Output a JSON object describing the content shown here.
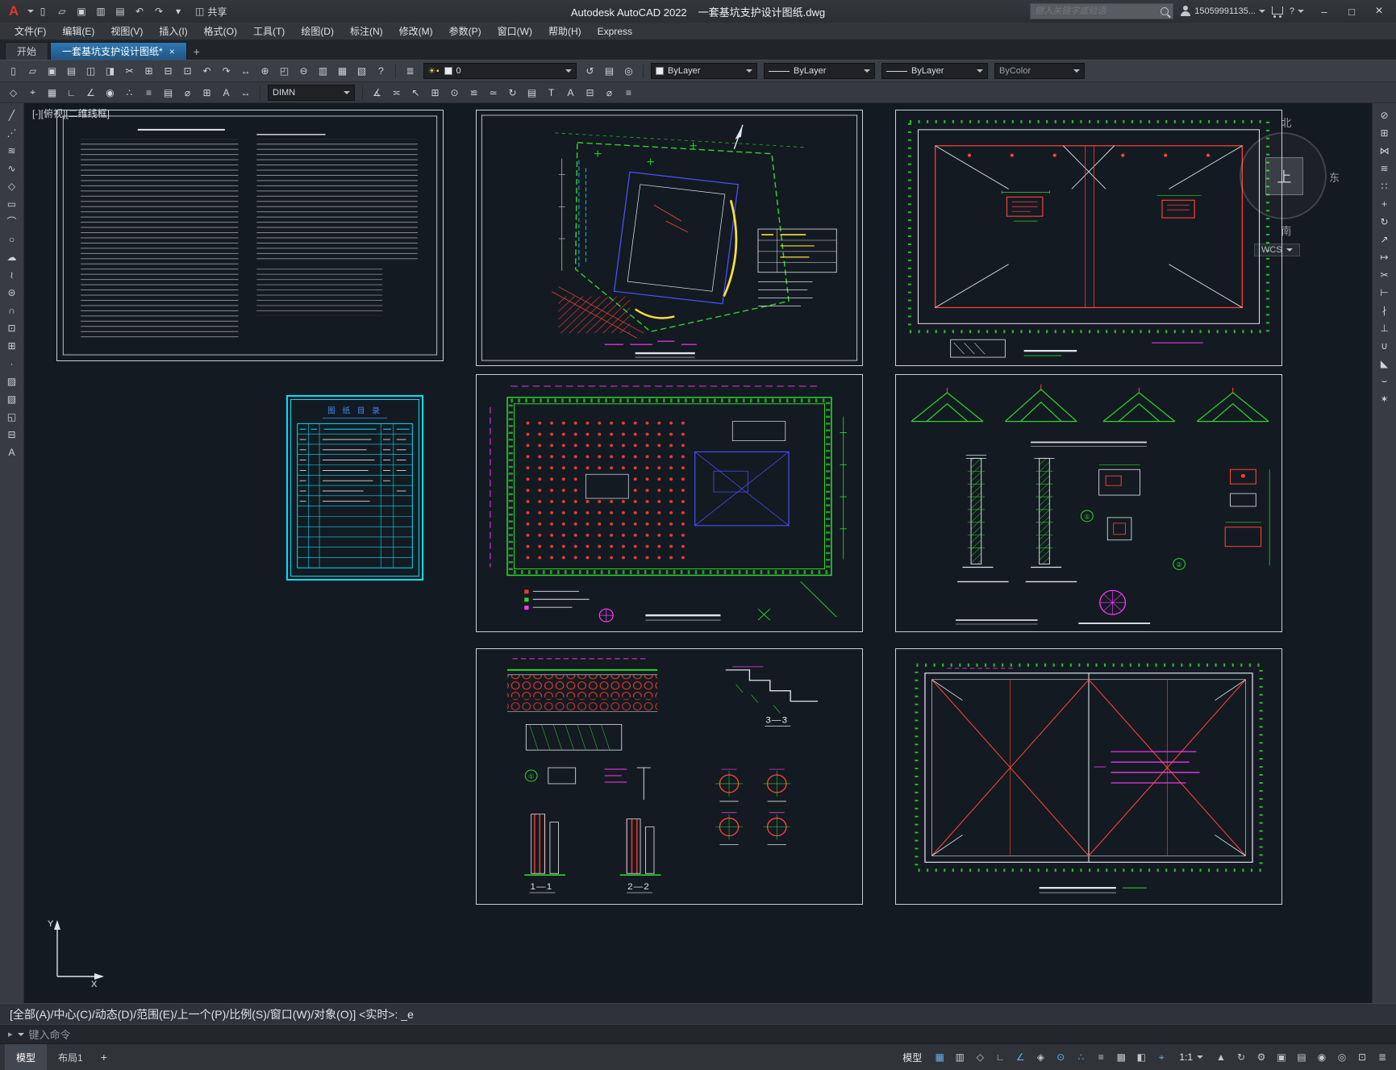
{
  "titlebar": {
    "logo_glyph": "A",
    "qat_icons": [
      {
        "name": "new-file-icon",
        "glyph": "▯"
      },
      {
        "name": "open-icon",
        "glyph": "▱"
      },
      {
        "name": "save-icon",
        "glyph": "▣"
      },
      {
        "name": "save-as-icon",
        "glyph": "▥"
      },
      {
        "name": "plot-icon",
        "glyph": "▤"
      },
      {
        "name": "undo-icon",
        "glyph": "↶"
      },
      {
        "name": "redo-icon",
        "glyph": "↷"
      },
      {
        "name": "qat-customize-icon",
        "glyph": "▾"
      }
    ],
    "share_icon_glyph": "◫",
    "share_label": "共享",
    "title_app": "Autodesk AutoCAD 2022",
    "title_file": "一套基坑支护设计图纸.dwg",
    "search_placeholder": "键入关键字或短语",
    "account_user": "15059991135...",
    "help_label": "?",
    "window": {
      "minimize": "–",
      "maximize": "□",
      "close": "×"
    }
  },
  "menubar": {
    "items": [
      {
        "name": "menu-file",
        "label": "文件(F)"
      },
      {
        "name": "menu-edit",
        "label": "编辑(E)"
      },
      {
        "name": "menu-view",
        "label": "视图(V)"
      },
      {
        "name": "menu-insert",
        "label": "插入(I)"
      },
      {
        "name": "menu-format",
        "label": "格式(O)"
      },
      {
        "name": "menu-tools",
        "label": "工具(T)"
      },
      {
        "name": "menu-draw",
        "label": "绘图(D)"
      },
      {
        "name": "menu-dimension",
        "label": "标注(N)"
      },
      {
        "name": "menu-modify",
        "label": "修改(M)"
      },
      {
        "name": "menu-parametric",
        "label": "参数(P)"
      },
      {
        "name": "menu-window",
        "label": "窗口(W)"
      },
      {
        "name": "menu-help",
        "label": "帮助(H)"
      },
      {
        "name": "menu-express",
        "label": "Express"
      }
    ]
  },
  "tabs": {
    "start_label": "开始",
    "doc_label": "一套基坑支护设计图纸*",
    "close_glyph": "×",
    "add_glyph": "+"
  },
  "toolbar_row1": {
    "icons": [
      {
        "name": "new-file-icon",
        "glyph": "▯"
      },
      {
        "name": "open-icon",
        "glyph": "▱"
      },
      {
        "name": "save-icon",
        "glyph": "▣"
      },
      {
        "name": "plot-icon",
        "glyph": "▤"
      },
      {
        "name": "plot-preview-icon",
        "glyph": "◫"
      },
      {
        "name": "publish-icon",
        "glyph": "◨"
      },
      {
        "name": "cut-icon",
        "glyph": "✂"
      },
      {
        "name": "copy-icon",
        "glyph": "⊞"
      },
      {
        "name": "paste-icon",
        "glyph": "⊟"
      },
      {
        "name": "match-properties-icon",
        "glyph": "⊡"
      },
      {
        "name": "undo-icon",
        "glyph": "↶"
      },
      {
        "name": "redo-icon",
        "glyph": "↷"
      },
      {
        "name": "pan-icon",
        "glyph": "↔"
      },
      {
        "name": "zoom-realtime-icon",
        "glyph": "⊕"
      },
      {
        "name": "zoom-window-icon",
        "glyph": "◰"
      },
      {
        "name": "zoom-previous-icon",
        "glyph": "⊖"
      },
      {
        "name": "properties-icon",
        "glyph": "▥"
      },
      {
        "name": "designcenter-icon",
        "glyph": "▦"
      },
      {
        "name": "tool-palettes-icon",
        "glyph": "▧"
      },
      {
        "name": "help-icon",
        "glyph": "?"
      }
    ],
    "layer_tool_icon": "≣",
    "layer_combo": {
      "state_icons": "☀▪",
      "value": "0"
    },
    "layer_extra_icons": [
      {
        "name": "layer-previous-icon",
        "glyph": "↺"
      },
      {
        "name": "layer-states-icon",
        "glyph": "▤"
      },
      {
        "name": "layer-isolate-icon",
        "glyph": "◎"
      }
    ],
    "color_value": "ByLayer",
    "linetype_value": "ByLayer",
    "lineweight_value": "ByLayer",
    "plotstyle_value": "ByColor"
  },
  "toolbar_row2": {
    "icons_left": [
      {
        "name": "infer-constraints-icon",
        "glyph": "◇"
      },
      {
        "name": "snap-icon",
        "glyph": "⌖"
      },
      {
        "name": "grid-icon",
        "glyph": "▦"
      },
      {
        "name": "ortho-icon",
        "glyph": "∟"
      },
      {
        "name": "polar-icon",
        "glyph": "∠"
      },
      {
        "name": "osnap-icon",
        "glyph": "◉"
      },
      {
        "name": "otrack-icon",
        "glyph": "∴"
      },
      {
        "name": "lineweight-icon",
        "glyph": "≡"
      },
      {
        "name": "quick-properties-icon",
        "glyph": "▤"
      },
      {
        "name": "measure-icon",
        "glyph": "⌀"
      },
      {
        "name": "table-icon",
        "glyph": "⊞"
      },
      {
        "name": "text-icon",
        "glyph": "A"
      },
      {
        "name": "dim-linear-icon",
        "glyph": "↔"
      }
    ],
    "dim_style_value": "DIMN",
    "icons_right": [
      {
        "name": "dim-aligned-icon",
        "glyph": "∡"
      },
      {
        "name": "quick-dim-icon",
        "glyph": "≍"
      },
      {
        "name": "leader-icon",
        "glyph": "↖"
      },
      {
        "name": "tolerance-icon",
        "glyph": "⊞"
      },
      {
        "name": "center-mark-icon",
        "glyph": "⊙"
      },
      {
        "name": "dim-edit-icon",
        "glyph": "≌"
      },
      {
        "name": "dim-text-edit-icon",
        "glyph": "≃"
      },
      {
        "name": "dim-update-icon",
        "glyph": "↻"
      },
      {
        "name": "dim-style-icon",
        "glyph": "▤"
      },
      {
        "name": "text-style-icon",
        "glyph": "T"
      },
      {
        "name": "mtext-icon",
        "glyph": "A"
      },
      {
        "name": "table-style-icon",
        "glyph": "⊟"
      },
      {
        "name": "distance-icon",
        "glyph": "⌀"
      },
      {
        "name": "list-icon",
        "glyph": "≡"
      }
    ]
  },
  "left_palette": {
    "icons": [
      {
        "name": "line-icon",
        "glyph": "╱"
      },
      {
        "name": "construction-line-icon",
        "glyph": "⋰"
      },
      {
        "name": "multiline-icon",
        "glyph": "≋"
      },
      {
        "name": "polyline-icon",
        "glyph": "∿"
      },
      {
        "name": "polygon-icon",
        "glyph": "◇"
      },
      {
        "name": "rectangle-icon",
        "glyph": "▭"
      },
      {
        "name": "arc-icon",
        "glyph": "⌒"
      },
      {
        "name": "circle-icon",
        "glyph": "○"
      },
      {
        "name": "revision-cloud-icon",
        "glyph": "☁"
      },
      {
        "name": "spline-icon",
        "glyph": "≀"
      },
      {
        "name": "ellipse-icon",
        "glyph": "⊜"
      },
      {
        "name": "ellipse-arc-icon",
        "glyph": "∩"
      },
      {
        "name": "insert-block-icon",
        "glyph": "⊡"
      },
      {
        "name": "create-block-icon",
        "glyph": "⊞"
      },
      {
        "name": "point-icon",
        "glyph": "·"
      },
      {
        "name": "hatch-icon",
        "glyph": "▨"
      },
      {
        "name": "gradient-icon",
        "glyph": "▧"
      },
      {
        "name": "region-icon",
        "glyph": "◱"
      },
      {
        "name": "table-icon",
        "glyph": "⊟"
      },
      {
        "name": "mtext-icon",
        "glyph": "A"
      }
    ]
  },
  "right_palette": {
    "icons": [
      {
        "name": "erase-icon",
        "glyph": "⊘"
      },
      {
        "name": "copy-icon",
        "glyph": "⊞"
      },
      {
        "name": "mirror-icon",
        "glyph": "⋈"
      },
      {
        "name": "offset-icon",
        "glyph": "≋"
      },
      {
        "name": "array-icon",
        "glyph": "∷"
      },
      {
        "name": "move-icon",
        "glyph": "+"
      },
      {
        "name": "rotate-icon",
        "glyph": "↻"
      },
      {
        "name": "scale-icon",
        "glyph": "↗"
      },
      {
        "name": "stretch-icon",
        "glyph": "↦"
      },
      {
        "name": "trim-icon",
        "glyph": "✂"
      },
      {
        "name": "extend-icon",
        "glyph": "⊢"
      },
      {
        "name": "break-icon",
        "glyph": "∤"
      },
      {
        "name": "break-at-point-icon",
        "glyph": "⊥"
      },
      {
        "name": "join-icon",
        "glyph": "∪"
      },
      {
        "name": "chamfer-icon",
        "glyph": "◣"
      },
      {
        "name": "fillet-icon",
        "glyph": "⌣"
      },
      {
        "name": "explode-icon",
        "glyph": "✶"
      }
    ]
  },
  "canvas": {
    "viewport_label": "[-][俯视][二维线框]",
    "compass": {
      "north": "北",
      "east": "东",
      "south": "南",
      "center": "上",
      "wcs": "WCS"
    },
    "ucs": {
      "x_label": "X",
      "y_label": "Y"
    },
    "marks": {
      "c1": "①",
      "c2": "②"
    },
    "sections": {
      "s33": "3—3",
      "s11": "1—1",
      "s22": "2—2"
    },
    "catalog_title": "图 纸 目 录"
  },
  "command": {
    "history": "[全部(A)/中心(C)/动态(D)/范围(E)/上一个(P)/比例(S)/窗口(W)/对象(O)] <实时>: _e",
    "prompt_icon": "▸",
    "prompt": "键入命令"
  },
  "statusbar": {
    "model_tab": "模型",
    "layout_tab": "布局1",
    "add_tab_glyph": "+",
    "model_chip": "模型",
    "icons_a": [
      {
        "name": "grid-icon",
        "glyph": "▦",
        "active": true
      },
      {
        "name": "snap-icon",
        "glyph": "▥"
      },
      {
        "name": "infer-constraints-icon",
        "glyph": "◇"
      },
      {
        "name": "ortho-icon",
        "glyph": "∟"
      },
      {
        "name": "polar-tracking-icon",
        "glyph": "∠",
        "active": true
      },
      {
        "name": "isodraft-icon",
        "glyph": "◈"
      },
      {
        "name": "osnap-icon",
        "glyph": "⊙",
        "active": true
      },
      {
        "name": "otrack-icon",
        "glyph": "∴",
        "active": true
      },
      {
        "name": "lineweight-icon",
        "glyph": "≡"
      },
      {
        "name": "transparency-icon",
        "glyph": "▩"
      },
      {
        "name": "selection-cycling-icon",
        "glyph": "◧"
      },
      {
        "name": "dynamic-input-icon",
        "glyph": "⌖",
        "active": true
      }
    ],
    "scale_chip": "1:1",
    "icons_b": [
      {
        "name": "annotation-visibility-icon",
        "glyph": "▲"
      },
      {
        "name": "autoscale-icon",
        "glyph": "↻"
      },
      {
        "name": "workspace-gear-icon",
        "glyph": "⚙"
      },
      {
        "name": "annotation-monitor-icon",
        "glyph": "▣"
      },
      {
        "name": "quick-properties-icon",
        "glyph": "▤"
      },
      {
        "name": "lock-ui-icon",
        "glyph": "◉"
      },
      {
        "name": "isolate-objects-icon",
        "glyph": "◎"
      },
      {
        "name": "clean-screen-icon",
        "glyph": "⊡"
      },
      {
        "name": "customization-icon",
        "glyph": "≣"
      }
    ]
  }
}
